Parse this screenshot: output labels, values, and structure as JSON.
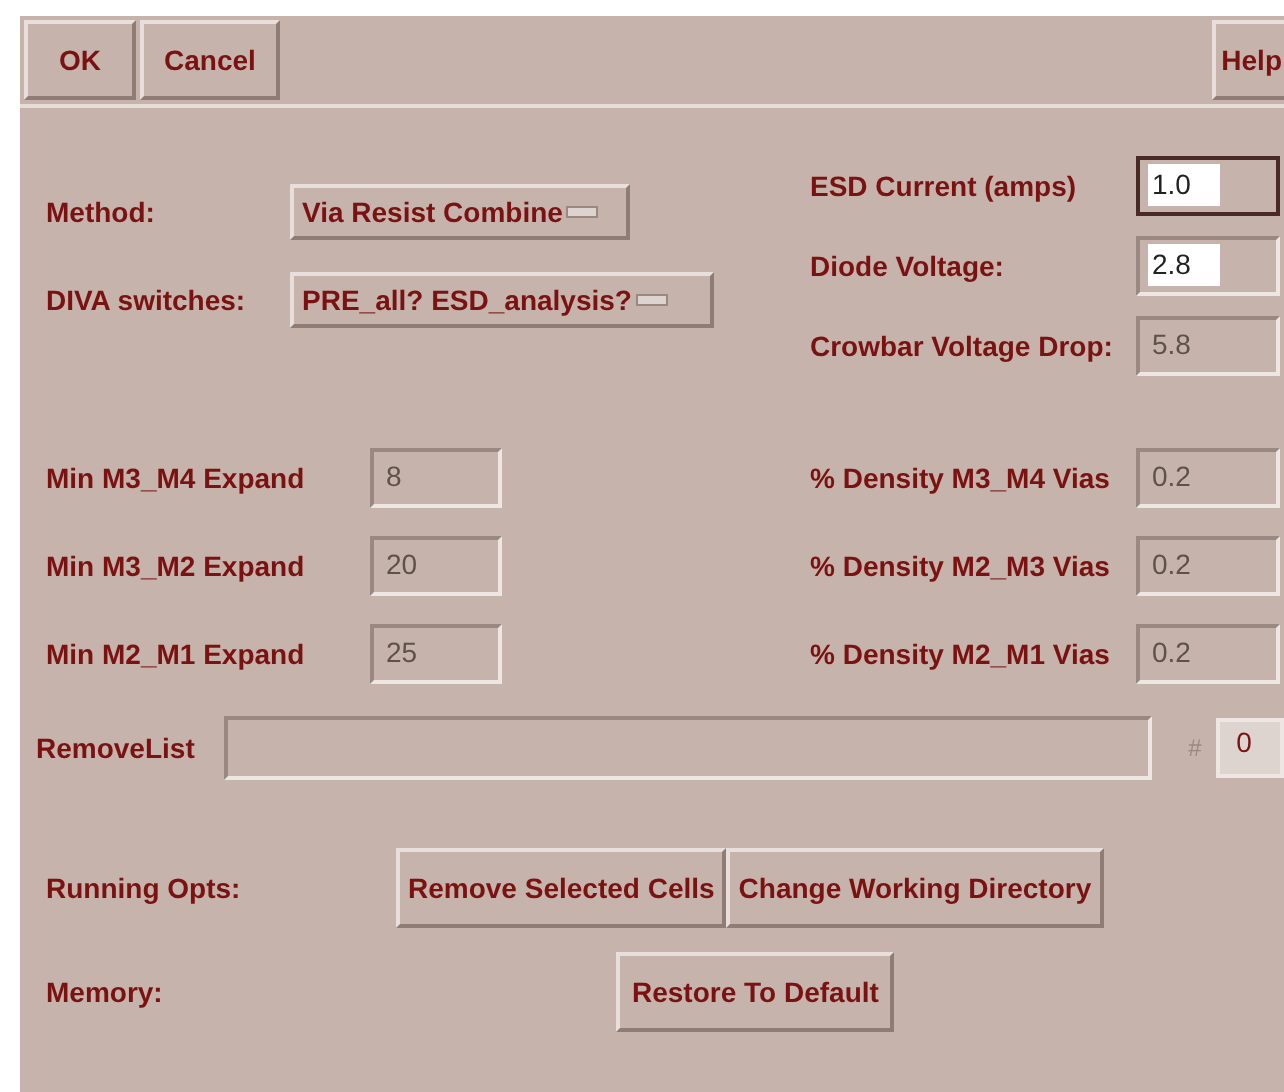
{
  "toolbar": {
    "buttons": [
      {
        "label": "OK"
      },
      {
        "label": "Cancel"
      }
    ],
    "help_button": "Help"
  },
  "method": {
    "label": "Method:",
    "value": "Via Resist Combine"
  },
  "diva_switches": {
    "label": "DIVA switches:",
    "value": "PRE_all? ESD_analysis?"
  },
  "esd_fields": [
    {
      "label": "ESD Current (amps)",
      "value": "1.0",
      "disabled": false,
      "focused": true
    },
    {
      "label": "Diode Voltage:",
      "value": "2.8",
      "disabled": false,
      "focused": false
    },
    {
      "label": "Crowbar Voltage Drop:",
      "value": "5.8",
      "disabled": true,
      "focused": false
    }
  ],
  "expand_fields": [
    {
      "label": "Min M3_M4 Expand",
      "value": "8",
      "disabled": true
    },
    {
      "label": "Min M3_M2 Expand",
      "value": "20",
      "disabled": true
    },
    {
      "label": "Min M2_M1 Expand",
      "value": "25",
      "disabled": true
    }
  ],
  "density_fields": [
    {
      "label": "% Density M3_M4 Vias",
      "value": "0.2",
      "disabled": true
    },
    {
      "label": "% Density M2_M3 Vias",
      "value": "0.2",
      "disabled": true
    },
    {
      "label": "% Density M2_M1 Vias",
      "value": "0.2",
      "disabled": true
    }
  ],
  "remove_list": {
    "label": "RemoveList",
    "count_label": "#",
    "count": "0"
  },
  "running_opts": {
    "label": "Running Opts:",
    "buttons": [
      "Remove Selected Cells",
      "Change Working Directory"
    ]
  },
  "memory": {
    "label": "Memory:",
    "button": "Restore To Default"
  }
}
